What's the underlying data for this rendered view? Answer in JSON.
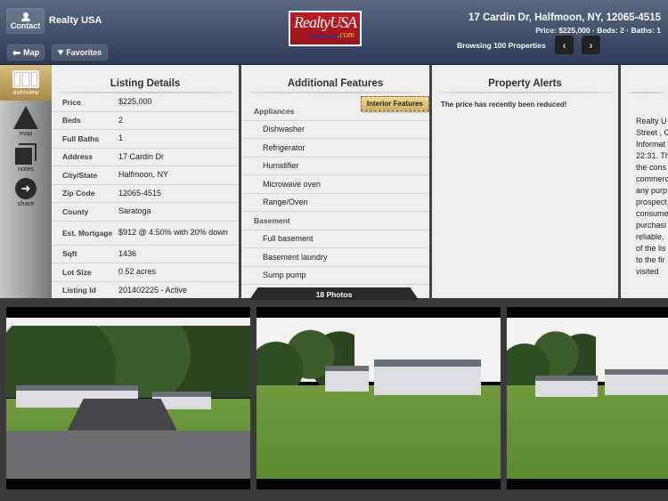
{
  "header": {
    "app_name": "Realty USA",
    "contact_label": "Contact",
    "map_label": "Map",
    "favorites_label": "Favorites",
    "logo_main": "RealtyUSA",
    "logo_com": ".com",
    "address": "17 Cardin Dr, Halfmoon, NY, 12065-4515",
    "summary": "Price: $225,000 · Beds: 2 · Baths: 1",
    "browsing": "Browsing 100 Properties",
    "prev_icon": "‹",
    "next_icon": "›"
  },
  "sidebar": {
    "items": [
      {
        "label": "overview",
        "active": true
      },
      {
        "label": "map"
      },
      {
        "label": "notes"
      },
      {
        "label": "share"
      }
    ]
  },
  "listing": {
    "title": "Listing Details",
    "rows": [
      {
        "k": "Price",
        "v": "$225,000"
      },
      {
        "k": "Beds",
        "v": "2"
      },
      {
        "k": "Full Baths",
        "v": "1"
      },
      {
        "k": "Address",
        "v": "17 Cardin Dr"
      },
      {
        "k": "City/State",
        "v": "Halfmoon, NY"
      },
      {
        "k": "Zip Code",
        "v": "12065-4515"
      },
      {
        "k": "County",
        "v": "Saratoga"
      },
      {
        "k": "Est. Mortgage",
        "v": "$912 @ 4.50% with 20% down"
      },
      {
        "k": "Sqft",
        "v": "1436"
      },
      {
        "k": "Lot Size",
        "v": "0.52 acres"
      },
      {
        "k": "Listing Id",
        "v": "201402225 - Active"
      }
    ]
  },
  "features": {
    "title": "Additional Features",
    "tag": "Interior Features",
    "rows": [
      {
        "type": "grp",
        "label": "Appliances"
      },
      {
        "type": "item",
        "label": "Dishwasher"
      },
      {
        "type": "item",
        "label": "Refrigerator"
      },
      {
        "type": "item",
        "label": "Humidifier"
      },
      {
        "type": "item",
        "label": "Microwave oven"
      },
      {
        "type": "item",
        "label": "Range/Oven"
      },
      {
        "type": "grp",
        "label": "Basement"
      },
      {
        "type": "item",
        "label": "Full basement"
      },
      {
        "type": "item",
        "label": "Basement laundry"
      },
      {
        "type": "item",
        "label": "Sump pump"
      }
    ]
  },
  "alerts": {
    "title": "Property Alerts",
    "message": "The price has recently been reduced!"
  },
  "disclaimer": {
    "lines": [
      "Realty U",
      "Street , C",
      "Informat",
      "22:31. Th",
      "the cons",
      "commerc",
      "any purp",
      "prospect",
      "consume",
      "purchasi",
      "reliable,",
      "of the lis",
      "to the fir",
      "visited"
    ]
  },
  "photos": {
    "count_label": "18 Photos",
    "items": [
      "front-of-house-with-driveway",
      "side-yard-with-gazebo",
      "backyard-with-garage"
    ]
  }
}
